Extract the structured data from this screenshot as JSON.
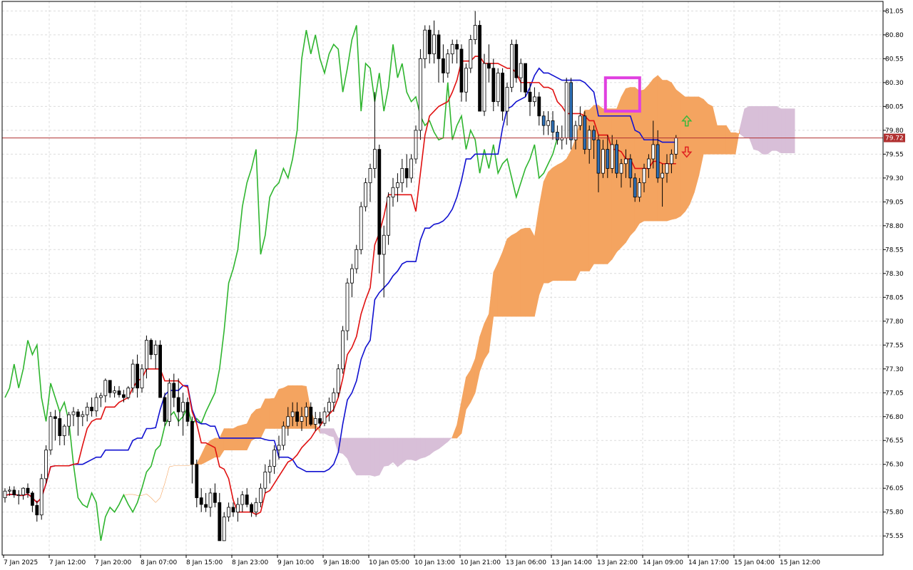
{
  "chart_data": {
    "type": "candlestick",
    "indicator": "Ichimoku Kinko Hyo",
    "current_price": "79.72",
    "ylim": [
      75.35,
      81.15
    ],
    "y_ticks": [
      "81.05",
      "80.80",
      "80.55",
      "80.30",
      "80.05",
      "79.80",
      "79.55",
      "79.30",
      "79.05",
      "78.80",
      "78.55",
      "78.30",
      "78.05",
      "77.80",
      "77.55",
      "77.30",
      "77.05",
      "76.80",
      "76.55",
      "76.30",
      "76.05",
      "75.80",
      "75.55"
    ],
    "x_ticks": [
      "7 Jan 2025",
      "7 Jan 12:00",
      "7 Jan 20:00",
      "8 Jan 07:00",
      "8 Jan 15:00",
      "8 Jan 23:00",
      "9 Jan 10:00",
      "9 Jan 18:00",
      "10 Jan 05:00",
      "10 Jan 13:00",
      "10 Jan 21:00",
      "13 Jan 06:00",
      "13 Jan 14:00",
      "13 Jan 22:00",
      "14 Jan 09:00",
      "14 Jan 17:00",
      "15 Jan 04:00",
      "15 Jan 12:00"
    ],
    "colors": {
      "bull": "#ffffff",
      "bear": "#000000",
      "last_bear": "#2e6fb5",
      "tenkan": "#e01010",
      "kijun": "#1010d0",
      "chikou": "#2fb52f",
      "kumo_bull": "#f4a460",
      "kumo_bear": "#d8bfd8",
      "price_line": "#b03030",
      "highlight": "#e040e0",
      "arrow_up": "#3cb83c",
      "arrow_down": "#e02020"
    },
    "candles": [
      [
        75.95,
        76.05,
        75.9,
        76.02
      ],
      [
        76.02,
        76.07,
        75.97,
        76.03
      ],
      [
        76.03,
        76.07,
        75.95,
        75.98
      ],
      [
        75.98,
        76.03,
        75.88,
        75.98
      ],
      [
        75.98,
        76.06,
        75.93,
        76.05
      ],
      [
        76.05,
        76.1,
        75.95,
        76.0
      ],
      [
        76.0,
        76.02,
        75.8,
        75.87
      ],
      [
        75.87,
        75.92,
        75.7,
        75.77
      ],
      [
        75.77,
        76.2,
        75.72,
        76.15
      ],
      [
        76.15,
        76.5,
        76.1,
        76.45
      ],
      [
        76.45,
        76.85,
        76.4,
        76.8
      ],
      [
        76.8,
        76.87,
        76.55,
        76.78
      ],
      [
        76.78,
        76.85,
        76.5,
        76.6
      ],
      [
        76.6,
        76.72,
        76.5,
        76.7
      ],
      [
        76.7,
        76.85,
        76.6,
        76.82
      ],
      [
        76.82,
        76.9,
        76.7,
        76.85
      ],
      [
        76.85,
        76.88,
        76.6,
        76.8
      ],
      [
        76.8,
        76.86,
        76.7,
        76.82
      ],
      [
        76.82,
        76.95,
        76.75,
        76.9
      ],
      [
        76.9,
        77.0,
        76.8,
        76.86
      ],
      [
        76.86,
        77.05,
        76.8,
        77.0
      ],
      [
        77.0,
        77.05,
        76.9,
        77.02
      ],
      [
        77.02,
        77.2,
        76.95,
        77.18
      ],
      [
        77.18,
        77.15,
        77.0,
        77.05
      ],
      [
        77.05,
        77.12,
        77.0,
        77.07
      ],
      [
        77.07,
        77.12,
        77.0,
        77.03
      ],
      [
        77.03,
        77.08,
        76.95,
        77.0
      ],
      [
        77.0,
        77.12,
        76.98,
        77.1
      ],
      [
        77.1,
        77.4,
        77.05,
        77.35
      ],
      [
        77.35,
        77.45,
        77.0,
        77.1
      ],
      [
        77.1,
        77.35,
        77.05,
        77.3
      ],
      [
        77.3,
        77.65,
        77.2,
        77.6
      ],
      [
        77.6,
        77.62,
        77.4,
        77.45
      ],
      [
        77.45,
        77.6,
        77.3,
        77.55
      ],
      [
        77.55,
        77.6,
        77.1,
        77.0
      ],
      [
        77.0,
        77.05,
        76.7,
        76.75
      ],
      [
        76.75,
        77.2,
        76.7,
        77.15
      ],
      [
        77.15,
        77.25,
        76.9,
        77.0
      ],
      [
        77.0,
        77.2,
        76.7,
        76.85
      ],
      [
        76.85,
        77.05,
        76.6,
        76.95
      ],
      [
        76.95,
        77.0,
        76.7,
        76.75
      ],
      [
        76.75,
        76.8,
        76.1,
        76.3
      ],
      [
        76.3,
        76.35,
        75.85,
        75.95
      ],
      [
        75.95,
        76.05,
        75.8,
        75.88
      ],
      [
        75.88,
        76.0,
        75.8,
        75.85
      ],
      [
        75.85,
        76.05,
        75.75,
        76.0
      ],
      [
        76.0,
        76.1,
        75.85,
        75.9
      ],
      [
        75.9,
        76.0,
        75.5,
        75.5
      ],
      [
        75.5,
        75.8,
        75.5,
        75.75
      ],
      [
        75.75,
        75.9,
        75.7,
        75.85
      ],
      [
        75.85,
        75.9,
        75.75,
        75.8
      ],
      [
        75.8,
        75.95,
        75.7,
        75.88
      ],
      [
        75.88,
        76.02,
        75.8,
        75.98
      ],
      [
        75.98,
        76.05,
        75.85,
        75.88
      ],
      [
        75.88,
        75.9,
        75.75,
        75.8
      ],
      [
        75.8,
        75.95,
        75.75,
        75.9
      ],
      [
        75.9,
        76.1,
        75.85,
        76.05
      ],
      [
        76.05,
        76.3,
        76.0,
        76.22
      ],
      [
        76.22,
        76.35,
        76.1,
        76.28
      ],
      [
        76.28,
        76.5,
        76.2,
        76.45
      ],
      [
        76.45,
        76.6,
        76.35,
        76.5
      ],
      [
        76.5,
        76.75,
        76.45,
        76.7
      ],
      [
        76.7,
        76.9,
        76.6,
        76.8
      ],
      [
        76.8,
        76.95,
        76.7,
        76.85
      ],
      [
        76.85,
        76.95,
        76.7,
        76.75
      ],
      [
        76.75,
        76.9,
        76.65,
        76.8
      ],
      [
        76.8,
        76.95,
        76.7,
        76.9
      ],
      [
        76.9,
        76.95,
        76.7,
        76.72
      ],
      [
        76.72,
        76.85,
        76.65,
        76.78
      ],
      [
        76.78,
        76.85,
        76.68,
        76.73
      ],
      [
        76.73,
        76.9,
        76.7,
        76.85
      ],
      [
        76.85,
        77.0,
        76.75,
        76.95
      ],
      [
        76.95,
        77.1,
        76.85,
        77.05
      ],
      [
        77.05,
        77.35,
        77.0,
        77.3
      ],
      [
        77.3,
        77.75,
        77.25,
        77.7
      ],
      [
        77.7,
        78.25,
        77.6,
        78.2
      ],
      [
        78.2,
        78.4,
        78.05,
        78.35
      ],
      [
        78.35,
        78.6,
        78.3,
        78.55
      ],
      [
        78.55,
        79.05,
        78.5,
        79.0
      ],
      [
        79.0,
        79.3,
        78.95,
        79.25
      ],
      [
        79.25,
        79.45,
        79.05,
        79.4
      ],
      [
        79.4,
        80.2,
        79.3,
        79.6
      ],
      [
        79.6,
        79.65,
        78.3,
        78.5
      ],
      [
        78.5,
        78.8,
        78.05,
        78.7
      ],
      [
        78.7,
        79.15,
        78.6,
        79.1
      ],
      [
        79.1,
        79.3,
        79.0,
        79.2
      ],
      [
        79.2,
        79.35,
        79.05,
        79.25
      ],
      [
        79.25,
        79.5,
        79.15,
        79.4
      ],
      [
        79.4,
        79.55,
        79.2,
        79.3
      ],
      [
        79.3,
        79.55,
        79.25,
        79.5
      ],
      [
        79.5,
        79.85,
        79.45,
        79.8
      ],
      [
        79.8,
        80.65,
        79.7,
        80.55
      ],
      [
        80.55,
        80.9,
        80.45,
        80.85
      ],
      [
        80.85,
        80.9,
        80.5,
        80.6
      ],
      [
        80.6,
        80.95,
        80.5,
        80.8
      ],
      [
        80.8,
        80.85,
        80.3,
        80.55
      ],
      [
        80.55,
        80.7,
        80.3,
        80.4
      ],
      [
        80.4,
        80.65,
        80.35,
        80.6
      ],
      [
        80.6,
        80.75,
        80.5,
        80.7
      ],
      [
        80.7,
        80.75,
        80.5,
        80.65
      ],
      [
        80.65,
        80.7,
        80.1,
        80.2
      ],
      [
        80.2,
        80.5,
        80.1,
        80.45
      ],
      [
        80.45,
        80.8,
        80.4,
        80.75
      ],
      [
        80.75,
        81.05,
        80.7,
        80.9
      ],
      [
        80.9,
        80.95,
        80.1,
        80.0
      ],
      [
        80.0,
        80.6,
        79.95,
        80.5
      ],
      [
        80.5,
        80.7,
        80.3,
        80.45
      ],
      [
        80.45,
        80.55,
        80.0,
        80.1
      ],
      [
        80.1,
        80.45,
        80.05,
        80.4
      ],
      [
        80.4,
        80.45,
        79.9,
        80.0
      ],
      [
        80.0,
        80.3,
        79.85,
        80.25
      ],
      [
        80.25,
        80.75,
        80.2,
        80.7
      ],
      [
        80.7,
        80.75,
        80.3,
        80.35
      ],
      [
        80.35,
        80.55,
        80.2,
        80.5
      ],
      [
        80.5,
        80.5,
        80.15,
        80.2
      ],
      [
        80.2,
        80.3,
        79.95,
        80.1
      ],
      [
        80.1,
        80.25,
        80.05,
        80.15
      ],
      [
        80.15,
        80.2,
        79.85,
        79.95
      ],
      [
        79.95,
        80.0,
        79.75,
        79.85
      ],
      [
        79.85,
        80.0,
        79.75,
        79.9
      ],
      [
        79.9,
        80.0,
        79.7,
        79.78
      ],
      [
        79.78,
        79.85,
        79.65,
        79.7
      ],
      [
        79.7,
        79.85,
        79.6,
        79.72
      ],
      [
        79.72,
        80.35,
        79.65,
        80.3
      ],
      [
        80.3,
        80.35,
        79.6,
        79.7
      ],
      [
        79.7,
        79.9,
        79.6,
        79.85
      ],
      [
        79.85,
        80.05,
        79.8,
        79.95
      ],
      [
        79.95,
        80.0,
        79.55,
        79.6
      ],
      [
        79.6,
        79.85,
        79.45,
        79.8
      ],
      [
        79.8,
        79.85,
        79.5,
        79.7
      ],
      [
        79.7,
        79.75,
        79.15,
        79.35
      ],
      [
        79.35,
        79.7,
        79.3,
        79.6
      ],
      [
        79.6,
        79.75,
        79.3,
        79.4
      ],
      [
        79.4,
        79.75,
        79.35,
        79.65
      ],
      [
        79.65,
        79.7,
        79.3,
        79.35
      ],
      [
        79.35,
        79.5,
        79.2,
        79.45
      ],
      [
        79.45,
        79.6,
        79.3,
        79.5
      ],
      [
        79.5,
        79.55,
        79.2,
        79.3
      ],
      [
        79.3,
        79.35,
        79.05,
        79.1
      ],
      [
        79.1,
        79.3,
        79.05,
        79.25
      ],
      [
        79.25,
        79.45,
        79.15,
        79.4
      ],
      [
        79.4,
        79.55,
        79.3,
        79.5
      ],
      [
        79.5,
        79.9,
        79.4,
        79.65
      ],
      [
        79.65,
        79.8,
        79.25,
        79.3
      ],
      [
        79.3,
        79.45,
        79.0,
        79.35
      ],
      [
        79.35,
        79.55,
        79.25,
        79.45
      ],
      [
        79.45,
        79.6,
        79.35,
        79.55
      ],
      [
        79.55,
        79.75,
        79.5,
        79.72
      ]
    ]
  }
}
